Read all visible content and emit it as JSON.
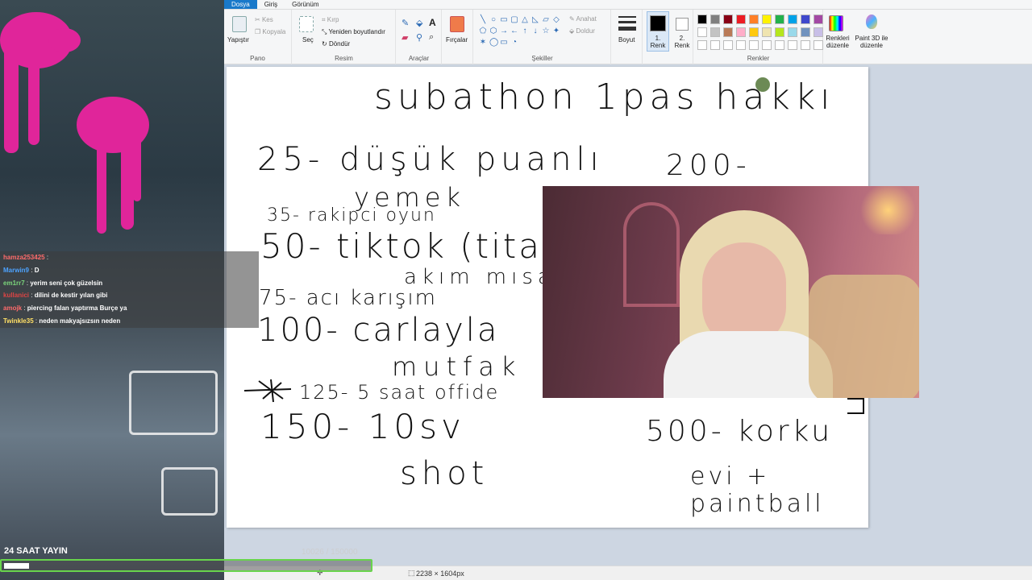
{
  "app": {
    "tabs": [
      "Dosya",
      "Giriş",
      "Görünüm"
    ],
    "ribbon": {
      "pano": {
        "label": "Pano",
        "paste": "Yapıştır",
        "cut": "Kes",
        "copy": "Kopyala"
      },
      "resim": {
        "label": "Resim",
        "select": "Seç",
        "crop": "Kırp",
        "resize": "Yeniden boyutlandır",
        "rotate": "Döndür"
      },
      "araclar": {
        "label": "Araçlar"
      },
      "firca": {
        "label": "Fırçalar"
      },
      "sekiller": {
        "label": "Şekiller",
        "outline": "Anahat",
        "fill": "Doldur"
      },
      "boyut": {
        "label": "Boyut"
      },
      "renk1": {
        "label": "1. Renk"
      },
      "renk2": {
        "label": "2. Renk"
      },
      "renkler": {
        "label": "Renkler",
        "edit": "Renkleri düzenle",
        "paint3d": "Paint 3D ile düzenle"
      }
    },
    "palette": [
      "#000000",
      "#7f7f7f",
      "#880015",
      "#ed1c24",
      "#ff7f27",
      "#fff200",
      "#22b14c",
      "#00a2e8",
      "#3f48cc",
      "#a349a4",
      "#ffffff",
      "#c3c3c3",
      "#b97a57",
      "#ffaec9",
      "#ffc90e",
      "#efe4b0",
      "#b5e61d",
      "#99d9ea",
      "#7092be",
      "#c8bfe7"
    ],
    "status": {
      "dimensions": "2238 × 1604px"
    }
  },
  "canvas": {
    "title": "subathon 1pas hakkı",
    "left_items": [
      "25- düşük puanlı",
      "yemek",
      "35- rakipci oyun",
      "50- tiktok (titan",
      "akım mısa",
      "75- acı karışım",
      "100- carlayla",
      "mutfak",
      "125- 5 saat offide",
      "150- 10sv",
      "shot"
    ],
    "right_items": [
      "200-",
      "500- korku",
      "evi + paintball"
    ]
  },
  "chat": [
    {
      "user": "hamza253425",
      "color": "#ff6b6b",
      "message": ""
    },
    {
      "user": "Marwin9",
      "color": "#4da3ff",
      "message": "D"
    },
    {
      "user": "em1rr7",
      "color": "#7cd67c",
      "message": "yerim seni çok güzelsin"
    },
    {
      "user": "kullanici",
      "color": "#d44",
      "message": "dilini de kestir yılan gibi"
    },
    {
      "user": "amojk",
      "color": "#ff6b6b",
      "message": "piercing falan yaptırma Burçe ya"
    },
    {
      "user": "Twinkle35",
      "color": "#ffe066",
      "message": "neden makyajsızsın neden"
    }
  ],
  "subathon": {
    "title": "24 SAAT YAYIN",
    "count": "10026 / 150000",
    "progress": 0.067
  }
}
